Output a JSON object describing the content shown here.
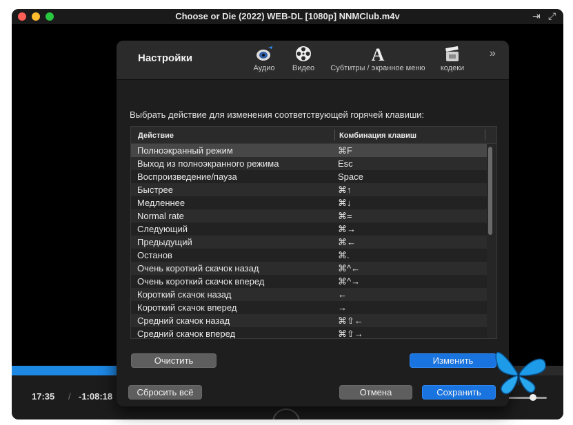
{
  "window": {
    "title": "Choose or Die (2022) WEB-DL [1080p] NNMClub.m4v",
    "title_icons": [
      "pin-icon",
      "fullscreen-icon"
    ]
  },
  "player": {
    "time_elapsed": "17:35",
    "time_separator": "/",
    "time_remaining": "-1:08:18",
    "colors": {
      "progress": "#1e88e5"
    }
  },
  "settings": {
    "title": "Настройки",
    "tabs": [
      {
        "label": "Аудио",
        "icon": "speaker-icon"
      },
      {
        "label": "Видео",
        "icon": "film-reel-icon"
      },
      {
        "label": "Субтитры / экранное меню",
        "icon": "font-a-icon"
      },
      {
        "label": "кодеки",
        "icon": "clapperboard-icon"
      }
    ],
    "more_icon": "»",
    "instruction": "Выбрать действие для изменения соответствующей горячей клавиши:",
    "table": {
      "columns": [
        "Действие",
        "Комбинация клавиш"
      ],
      "rows": [
        {
          "action": "Полноэкранный режим",
          "keys": "⌘F",
          "selected": true
        },
        {
          "action": "Выход из полноэкранного режима",
          "keys": "Esc"
        },
        {
          "action": "Воспроизведение/пауза",
          "keys": "Space"
        },
        {
          "action": "Быстрее",
          "keys": "⌘↑"
        },
        {
          "action": "Медленнее",
          "keys": "⌘↓"
        },
        {
          "action": "Normal rate",
          "keys": "⌘="
        },
        {
          "action": "Следующий",
          "keys": "⌘→"
        },
        {
          "action": "Предыдущий",
          "keys": "⌘←"
        },
        {
          "action": "Останов",
          "keys": "⌘."
        },
        {
          "action": "Очень короткий скачок назад",
          "keys": "⌘^←"
        },
        {
          "action": "Очень короткий скачок вперед",
          "keys": "⌘^→"
        },
        {
          "action": "Короткий скачок назад",
          "keys": "←"
        },
        {
          "action": "Короткий скачок вперед",
          "keys": "→"
        },
        {
          "action": "Средний скачок назад",
          "keys": "⌘⇧←"
        },
        {
          "action": "Средний скачок вперед",
          "keys": "⌘⇧→"
        }
      ]
    },
    "buttons": {
      "clear": "Очистить",
      "change": "Изменить",
      "reset_all": "Сбросить всё",
      "cancel": "Отмена",
      "save": "Сохранить"
    },
    "colors": {
      "primary_button": "#1a74e0",
      "selected_row": "#474747"
    }
  }
}
